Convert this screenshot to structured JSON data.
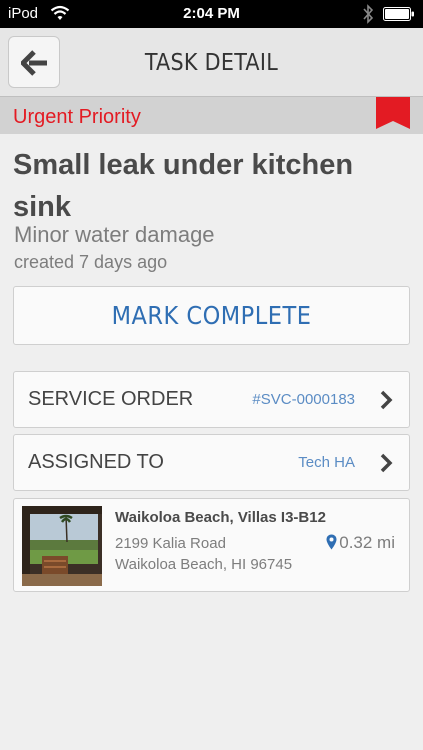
{
  "status_bar": {
    "carrier": "iPod",
    "time": "2:04 PM"
  },
  "nav": {
    "title": "TASK DETAIL",
    "back_icon": "arrow-left-icon"
  },
  "priority": {
    "label": "Urgent Priority",
    "flag_color": "#e31b23"
  },
  "task": {
    "title": "Small leak under kitchen sink",
    "subtitle": "Minor water damage",
    "created": "created 7 days ago"
  },
  "actions": {
    "mark_complete": "MARK COMPLETE"
  },
  "rows": [
    {
      "label": "SERVICE ORDER",
      "value": "#SVC-0000183"
    },
    {
      "label": "ASSIGNED TO",
      "value": "Tech HA"
    }
  ],
  "location": {
    "name": "Waikoloa Beach, Villas I3-B12",
    "address_line1": "2199 Kalia Road",
    "address_line2": "Waikoloa Beach, HI 96745",
    "distance": "0.32 mi"
  },
  "colors": {
    "accent_blue": "#2f6eb3",
    "link_blue": "#5b8cc4",
    "priority_red": "#e31b23"
  }
}
